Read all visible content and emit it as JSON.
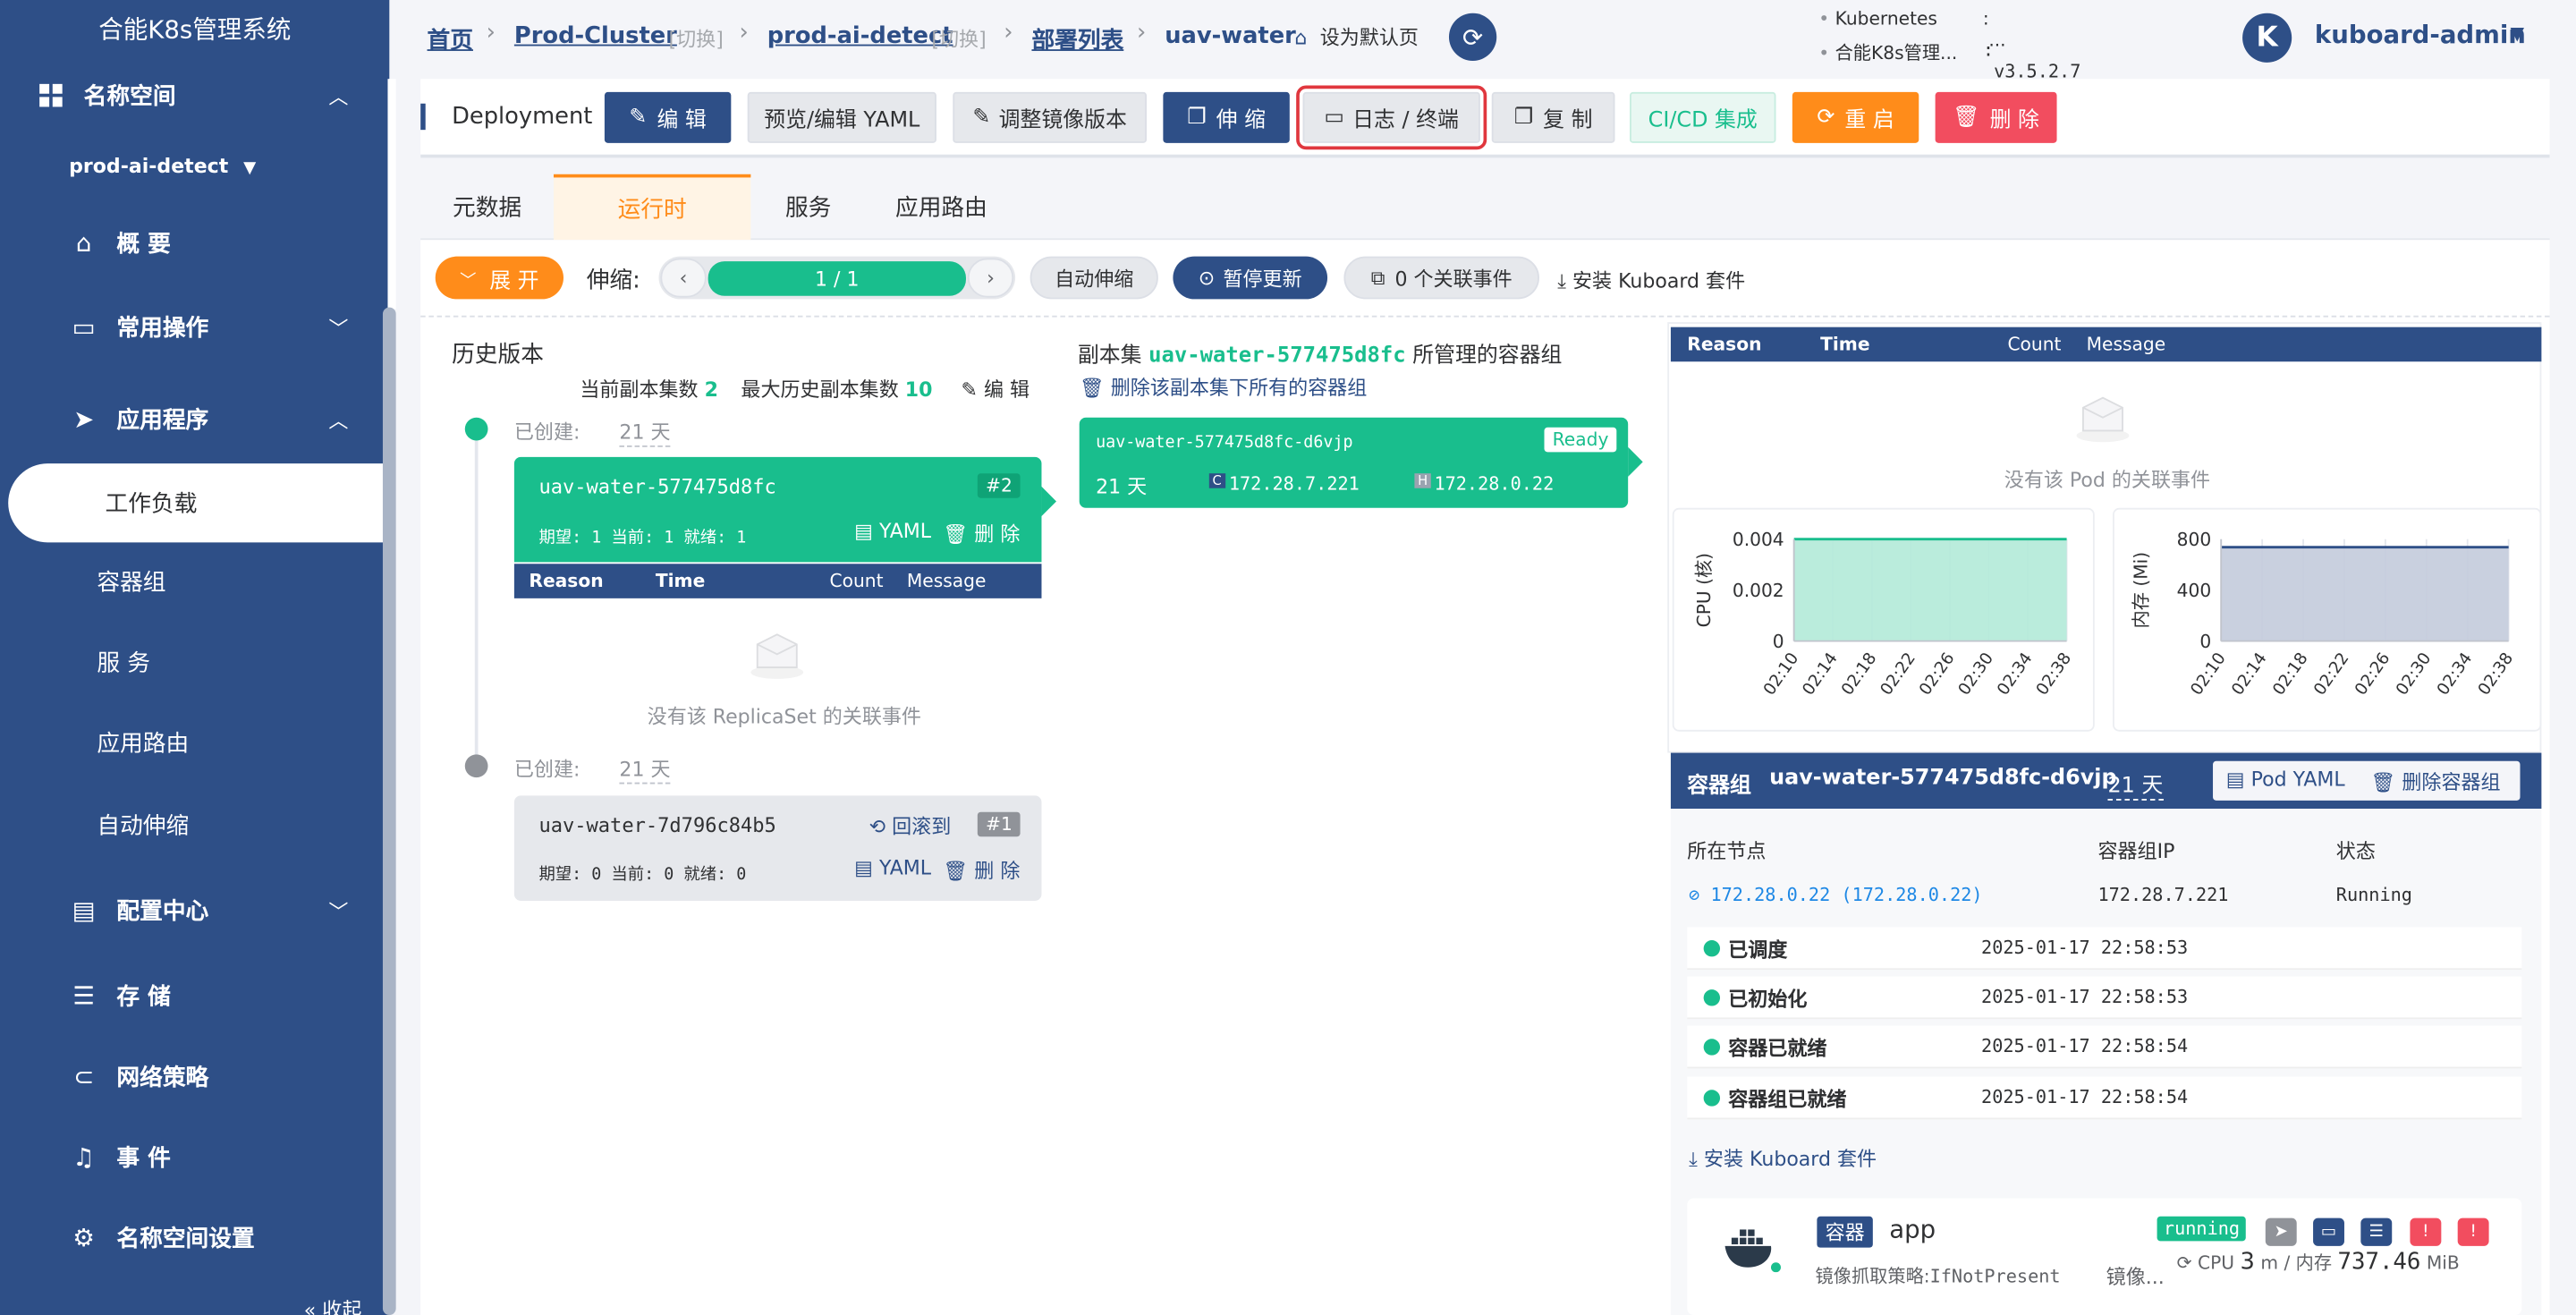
{
  "sidebar": {
    "brand": "合能K8s管理系统",
    "namespace_section": "名称空间",
    "namespace_selected": "prod-ai-detect",
    "items": {
      "overview": "概 要",
      "common_ops": "常用操作",
      "apps": "应用程序",
      "workloads": "工作负载",
      "pods": "容器组",
      "services": "服 务",
      "ingress": "应用路由",
      "autoscale": "自动伸缩",
      "config": "配置中心",
      "storage": "存 储",
      "netpolicy": "网络策略",
      "events": "事 件",
      "ns_settings": "名称空间设置",
      "collapse": "收起"
    }
  },
  "header": {
    "breadcrumb": {
      "home": "首页",
      "cluster": "Prod-Cluster",
      "switch1": "[切换]",
      "namespace": "prod-ai-detect",
      "switch2": "[切换]",
      "deploy_list": "部署列表",
      "current": "uav-water",
      "set_default": "设为默认页"
    },
    "info": {
      "k8s_label": "Kubernetes",
      "k8s_value": "...",
      "sys_label": "合能K8s管理...",
      "sys_value": "v3.5.2.7"
    },
    "user": {
      "initial": "K",
      "name": "kuboard-admin"
    }
  },
  "toolbar": {
    "kind": "Deployment",
    "edit": "编 辑",
    "yaml": "预览/编辑 YAML",
    "image": "调整镜像版本",
    "scale": "伸 缩",
    "logs": "日志 / 终端",
    "copy": "复 制",
    "cicd": "CI/CD 集成",
    "restart": "重 启",
    "delete": "删 除"
  },
  "tabs": {
    "meta": "元数据",
    "runtime": "运行时",
    "service": "服务",
    "route": "应用路由"
  },
  "controls": {
    "expand": "展 开",
    "scale_label": "伸缩:",
    "scale_value": "1 / 1",
    "autoscale": "自动伸缩",
    "pause": "暂停更新",
    "events": "0 个关联事件",
    "install": "安装 Kuboard 套件"
  },
  "history": {
    "title": "历史版本",
    "cur_label": "当前副本集数",
    "cur_value": "2",
    "max_label": "最大历史副本集数",
    "max_value": "10",
    "edit": "编 辑",
    "created_label": "已创建:",
    "rs1": {
      "age": "21 天",
      "name": "uav-water-577475d8fc",
      "rev": "#2",
      "stats": "期望: 1 当前: 1 就绪: 1",
      "yaml": "YAML",
      "delete": "删 除"
    },
    "rs2": {
      "age": "21 天",
      "name": "uav-water-7d796c84b5",
      "rollback": "回滚到",
      "rev": "#1",
      "stats": "期望: 0 当前: 0 就绪: 0",
      "yaml": "YAML",
      "delete": "删 除"
    },
    "event_cols": {
      "reason": "Reason",
      "time": "Time",
      "count": "Count",
      "message": "Message"
    },
    "no_events": "没有该 ReplicaSet 的关联事件"
  },
  "replicaset": {
    "title_pre": "副本集",
    "title_name": "uav-water-577475d8fc",
    "title_post": "所管理的容器组",
    "delete_all": "删除该副本集下所有的容器组",
    "pod": {
      "name": "uav-water-577475d8fc-d6vjp",
      "status": "Ready",
      "age": "21 天",
      "c_tag": "C",
      "pod_ip": "172.28.7.221",
      "h_tag": "H",
      "host_ip": "172.28.0.22"
    }
  },
  "pod_events": {
    "cols": {
      "reason": "Reason",
      "time": "Time",
      "count": "Count",
      "message": "Message"
    },
    "none": "没有该 Pod 的关联事件"
  },
  "chart_data": [
    {
      "type": "area",
      "ylabel": "CPU (核)",
      "ylim": [
        0,
        0.004
      ],
      "yticks": [
        "0.004",
        "0.002",
        "0"
      ],
      "x": [
        "02:10",
        "02:14",
        "02:18",
        "02:22",
        "02:26",
        "02:30",
        "02:34",
        "02:38"
      ],
      "values": [
        0.004,
        0.004,
        0.004,
        0.004,
        0.004,
        0.004,
        0.004,
        0.004
      ],
      "color": "#19be8d",
      "fill": "#b2ead8",
      "grid": true
    },
    {
      "type": "area",
      "ylabel": "内存 (Mi)",
      "ylim": [
        0,
        800
      ],
      "yticks": [
        "800",
        "400",
        "0"
      ],
      "x": [
        "02:10",
        "02:14",
        "02:18",
        "02:22",
        "02:26",
        "02:30",
        "02:34",
        "02:38"
      ],
      "values": [
        737,
        737,
        737,
        737,
        737,
        737,
        737,
        737
      ],
      "color": "#2e4f87",
      "fill": "#c3cbdb",
      "grid": true
    }
  ],
  "pod_panel": {
    "title_label": "容器组",
    "name": "uav-water-577475d8fc-d6vjp",
    "age": "21 天",
    "yaml_btn": "Pod YAML",
    "delete_btn": "删除容器组",
    "node_label": "所在节点",
    "ip_label": "容器组IP",
    "state_label": "状态",
    "node_value": "172.28.0.22 (172.28.0.22)",
    "ip_value": "172.28.7.221",
    "state_value": "Running",
    "conditions": [
      {
        "name": "已调度",
        "time": "2025-01-17 22:58:53"
      },
      {
        "name": "已初始化",
        "time": "2025-01-17 22:58:53"
      },
      {
        "name": "容器已就绪",
        "time": "2025-01-17 22:58:54"
      },
      {
        "name": "容器组已就绪",
        "time": "2025-01-17 22:58:54"
      }
    ],
    "install": "安装 Kuboard 套件",
    "container": {
      "tag": "容器",
      "name": "app",
      "status": "running",
      "pull_label": "镜像抓取策略:",
      "pull_value": "IfNotPresent",
      "image_label": "镜像...",
      "cpu_label": "CPU",
      "cpu_value": "3",
      "cpu_unit": "m",
      "mem_label": "/ 内存",
      "mem_value": "737.46",
      "mem_unit": "MiB"
    }
  }
}
